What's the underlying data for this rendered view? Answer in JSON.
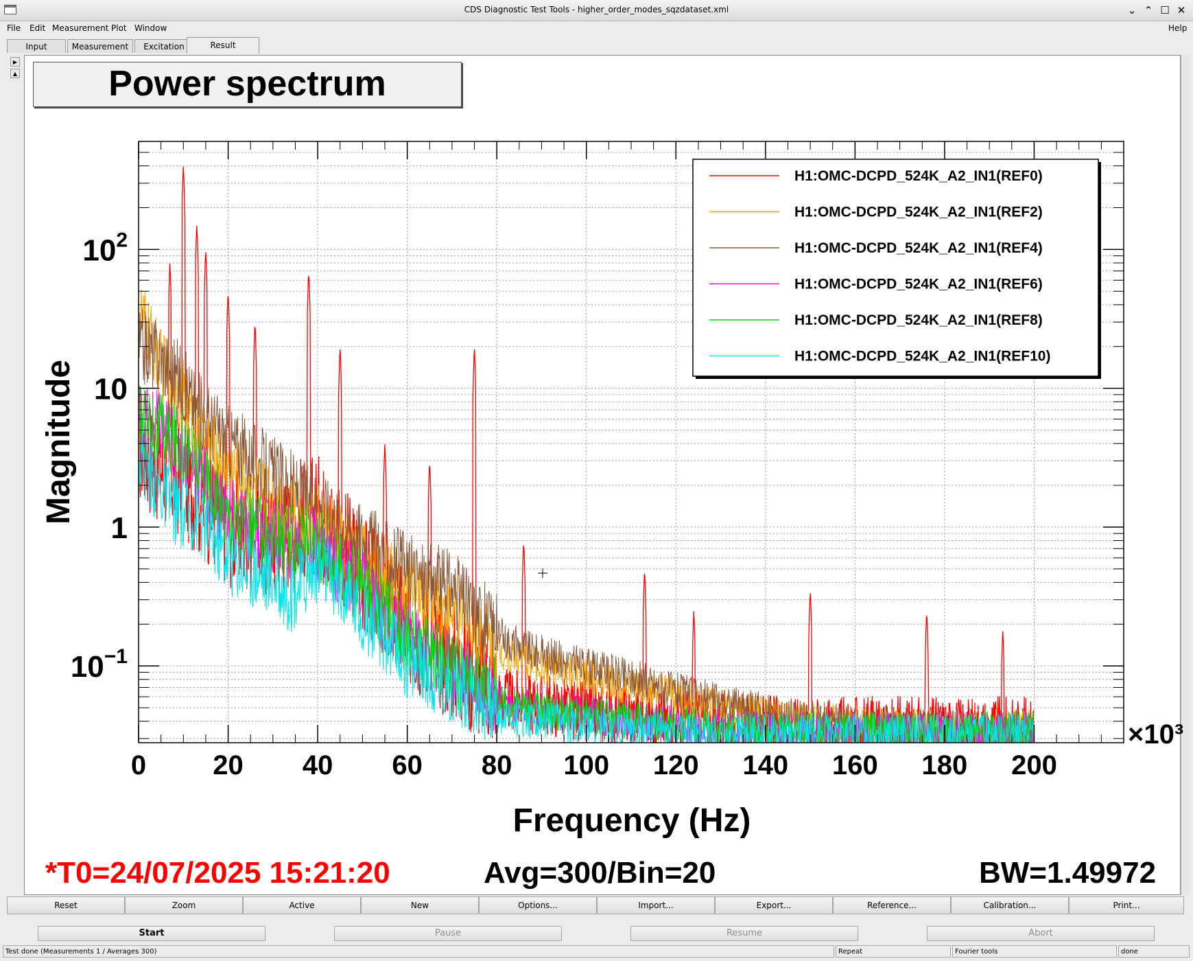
{
  "window": {
    "title": "CDS Diagnostic Test Tools - higher_order_modes_sqzdataset.xml",
    "controls": [
      "⌄",
      "⌃",
      "☐",
      "✕"
    ]
  },
  "menu": {
    "items": [
      "File",
      "Edit",
      "Measurement",
      "Plot",
      "Window"
    ],
    "help": "Help"
  },
  "tabs": [
    "Input",
    "Measurement",
    "Excitation",
    "Result"
  ],
  "active_tab": "Result",
  "plot": {
    "title": "Power spectrum",
    "t0": "*T0=24/07/2025 15:21:20",
    "avg": "Avg=300/Bin=20",
    "bw": "BW=1.49972",
    "multiplier": "×10³"
  },
  "chart_data": {
    "type": "line",
    "xlabel": "Frequency (Hz)",
    "ylabel": "Magnitude",
    "x_scale_note": "×10³",
    "x_ticks": [
      "0",
      "20",
      "40",
      "60",
      "80",
      "100",
      "120",
      "140",
      "160",
      "180",
      "200"
    ],
    "y_ticks": [
      {
        "base": "10",
        "exp": "2"
      },
      {
        "base": "10",
        "exp": ""
      },
      {
        "base": "1",
        "exp": ""
      },
      {
        "base": "10",
        "exp": "−1"
      }
    ],
    "xlim": [
      0,
      220
    ],
    "ylim": [
      0.028,
      600
    ],
    "yscale": "log",
    "grid": true,
    "legend_position": "top-right",
    "series": [
      {
        "name": "H1:OMC-DCPD_524K_A2_IN1(REF0)",
        "color": "#ff0000",
        "x": [
          0,
          5,
          10,
          13,
          20,
          30,
          40,
          50,
          60,
          70,
          80,
          90,
          100,
          110,
          120,
          130,
          140,
          150,
          160,
          170,
          180,
          190,
          200
        ],
        "y": [
          3.0,
          2.0,
          1.6,
          1.3,
          0.75,
          0.6,
          0.95,
          0.35,
          0.14,
          0.08,
          0.05,
          0.045,
          0.04,
          0.038,
          0.035,
          0.033,
          0.032,
          0.031,
          0.031,
          0.031,
          0.031,
          0.031,
          0.031
        ],
        "peaks": [
          [
            7,
            80
          ],
          [
            10,
            400
          ],
          [
            13,
            150
          ],
          [
            15,
            100
          ],
          [
            20,
            50
          ],
          [
            26,
            30
          ],
          [
            38,
            70
          ],
          [
            45,
            20
          ],
          [
            55,
            4
          ],
          [
            65,
            3
          ],
          [
            75,
            20
          ],
          [
            86,
            0.8
          ],
          [
            113,
            0.5
          ],
          [
            124,
            0.25
          ],
          [
            150,
            0.35
          ],
          [
            176,
            0.25
          ],
          [
            193,
            0.18
          ]
        ]
      },
      {
        "name": "H1:OMC-DCPD_524K_A2_IN1(REF2)",
        "color": "#ffa500",
        "x": [
          0,
          5,
          10,
          13,
          20,
          30,
          40,
          50,
          60,
          70,
          80,
          90,
          100,
          110,
          120,
          130,
          140,
          150,
          160,
          170,
          180,
          190,
          200
        ],
        "y": [
          30,
          12,
          7,
          4,
          2.2,
          1.3,
          0.9,
          0.5,
          0.3,
          0.2,
          0.12,
          0.09,
          0.075,
          0.065,
          0.055,
          0.045,
          0.04,
          0.036,
          0.034,
          0.033,
          0.032,
          0.032,
          0.032
        ]
      },
      {
        "name": "H1:OMC-DCPD_524K_A2_IN1(REF4)",
        "color": "#8b5a3c",
        "x": [
          0,
          5,
          10,
          13,
          20,
          30,
          40,
          50,
          60,
          70,
          80,
          90,
          100,
          110,
          120,
          130,
          140,
          150,
          160,
          170,
          180,
          190,
          200
        ],
        "y": [
          17,
          14,
          9,
          6,
          3.5,
          2.0,
          1.2,
          0.7,
          0.4,
          0.3,
          0.15,
          0.11,
          0.09,
          0.075,
          0.06,
          0.05,
          0.042,
          0.037,
          0.035,
          0.033,
          0.032,
          0.032,
          0.032
        ]
      },
      {
        "name": "H1:OMC-DCPD_524K_A2_IN1(REF6)",
        "color": "#ff00ff",
        "x": [
          0,
          5,
          10,
          13,
          20,
          30,
          40,
          50,
          60,
          70,
          80,
          90,
          100,
          110,
          120,
          130,
          140,
          150,
          160,
          170,
          180,
          190,
          200
        ],
        "y": [
          5.0,
          4.2,
          3.0,
          2.2,
          1.0,
          0.7,
          0.6,
          0.3,
          0.13,
          0.08,
          0.05,
          0.044,
          0.04,
          0.037,
          0.034,
          0.032,
          0.031,
          0.031,
          0.031,
          0.031,
          0.031,
          0.031,
          0.031
        ]
      },
      {
        "name": "H1:OMC-DCPD_524K_A2_IN1(REF8)",
        "color": "#00dd00",
        "x": [
          0,
          5,
          10,
          13,
          20,
          30,
          40,
          50,
          60,
          70,
          80,
          90,
          100,
          110,
          120,
          130,
          140,
          150,
          160,
          170,
          180,
          190,
          200
        ],
        "y": [
          5.0,
          4.0,
          3.2,
          2.3,
          1.0,
          0.7,
          0.6,
          0.3,
          0.13,
          0.08,
          0.05,
          0.044,
          0.04,
          0.037,
          0.034,
          0.032,
          0.031,
          0.031,
          0.031,
          0.031,
          0.031,
          0.031,
          0.031
        ]
      },
      {
        "name": "H1:OMC-DCPD_524K_A2_IN1(REF10)",
        "color": "#00e5ee",
        "x": [
          0,
          5,
          10,
          13,
          20,
          30,
          34,
          40,
          50,
          60,
          70,
          80,
          90,
          100,
          110,
          120,
          130,
          140,
          150,
          160,
          170,
          180,
          190,
          200
        ],
        "y": [
          2.8,
          1.5,
          1.0,
          1.0,
          0.5,
          0.35,
          0.27,
          0.45,
          0.2,
          0.09,
          0.06,
          0.04,
          0.037,
          0.034,
          0.032,
          0.031,
          0.03,
          0.03,
          0.03,
          0.03,
          0.03,
          0.03,
          0.03,
          0.03
        ]
      }
    ]
  },
  "buttons": [
    "Reset",
    "Zoom",
    "Active",
    "New",
    "Options...",
    "Import...",
    "Export...",
    "Reference...",
    "Calibration...",
    "Print..."
  ],
  "run_buttons": [
    {
      "label": "Start",
      "enabled": true
    },
    {
      "label": "Pause",
      "enabled": false
    },
    {
      "label": "Resume",
      "enabled": false
    },
    {
      "label": "Abort",
      "enabled": false
    }
  ],
  "status": [
    "Test done (Measurements 1 / Averages 300)",
    "Repeat",
    "Fourier tools",
    "done"
  ]
}
